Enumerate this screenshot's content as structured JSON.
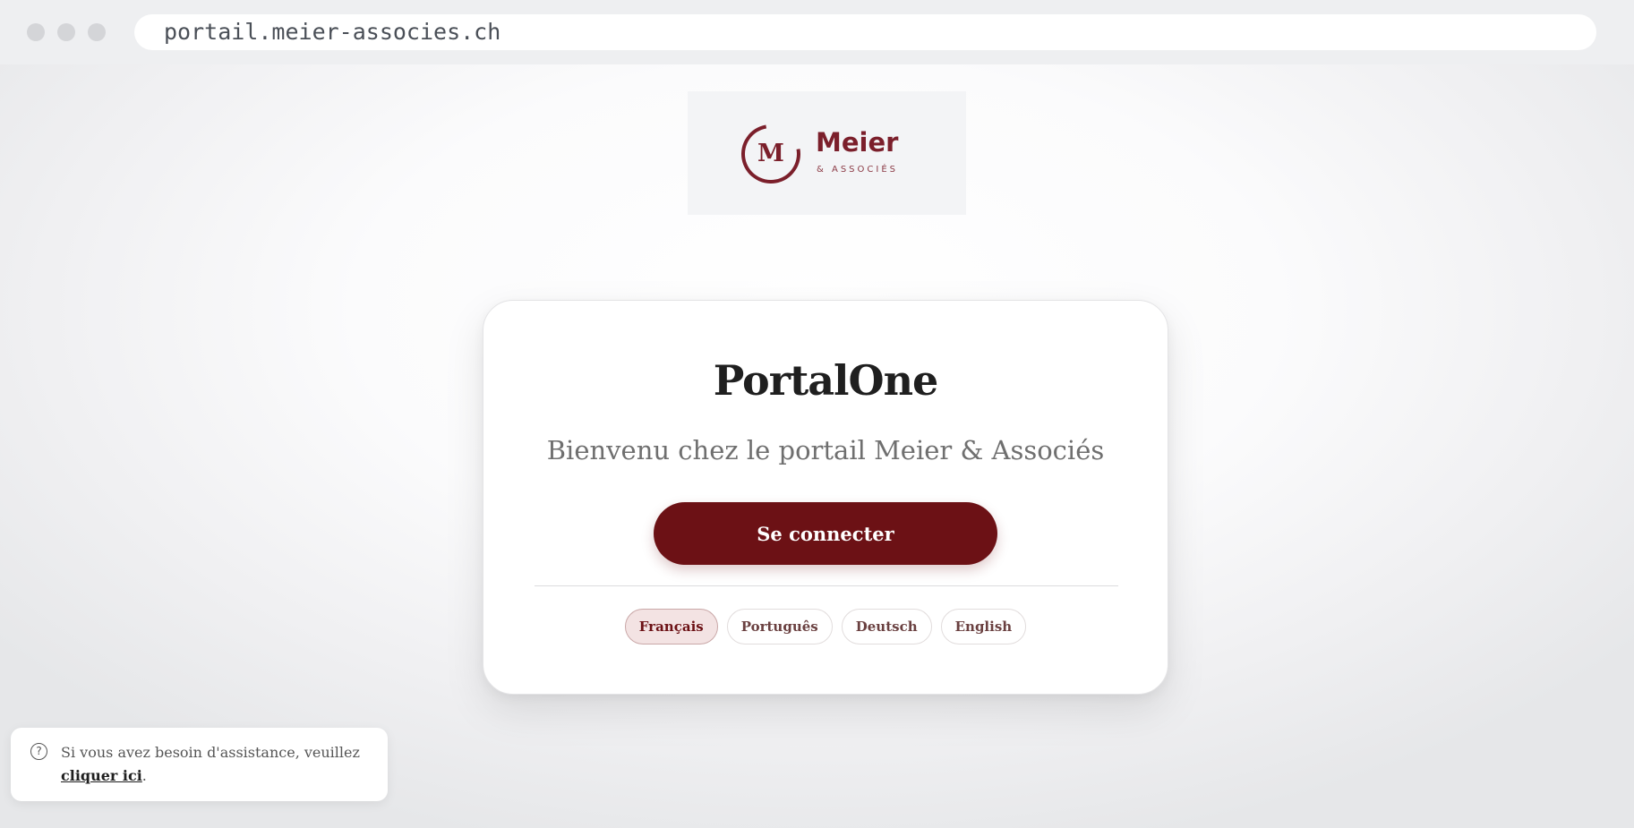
{
  "browser": {
    "url": "portail.meier-associes.ch"
  },
  "logo": {
    "mark": "M",
    "name": "Meier",
    "sub": "& ASSOCIÉS",
    "color": "#7b1f2b"
  },
  "card": {
    "title": "PortalOne",
    "subtitle": "Bienvenu chez le portail Meier & Associés",
    "login_label": "Se connecter",
    "accent": "#6c1115"
  },
  "languages": [
    {
      "label": "Français",
      "active": true
    },
    {
      "label": "Português",
      "active": false
    },
    {
      "label": "Deutsch",
      "active": false
    },
    {
      "label": "English",
      "active": false
    }
  ],
  "help": {
    "icon": "question-circle-icon",
    "text": "Si vous avez besoin d'assistance, veuillez",
    "link": "cliquer ici",
    "suffix": "."
  }
}
